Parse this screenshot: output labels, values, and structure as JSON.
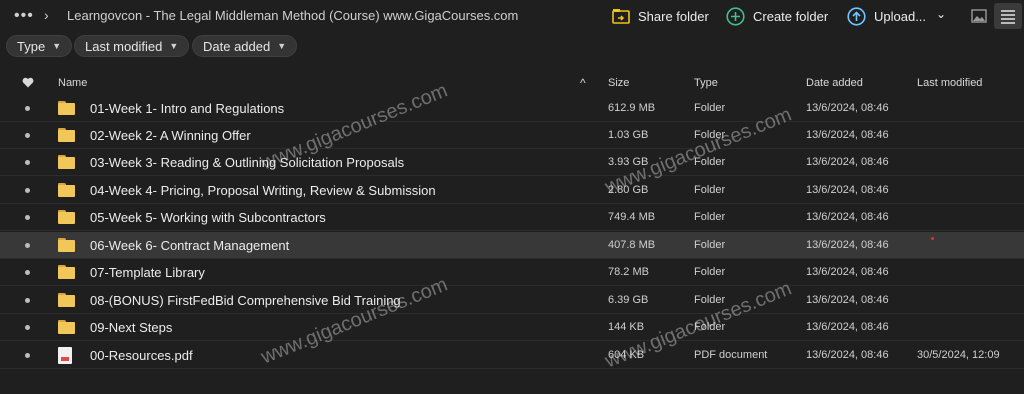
{
  "breadcrumb": {
    "more": "•••",
    "separator": "›",
    "title": "Learngovcon - The Legal Middleman Method (Course) www.GigaCourses.com"
  },
  "toolbar": {
    "share_folder": "Share folder",
    "create_folder": "Create folder",
    "upload": "Upload...",
    "upload_caret": "⌄"
  },
  "filters": [
    {
      "label": "Type"
    },
    {
      "label": "Last modified"
    },
    {
      "label": "Date added"
    }
  ],
  "table": {
    "headers": {
      "name": "Name",
      "size": "Size",
      "type": "Type",
      "date_added": "Date added",
      "last_modified": "Last modified",
      "sort_indicator": "^"
    },
    "rows": [
      {
        "name": "01-Week 1- Intro and Regulations",
        "size": "612.9 MB",
        "type": "Folder",
        "date_added": "13/6/2024, 08:46",
        "last_modified": "",
        "icon": "folder-icon"
      },
      {
        "name": "02-Week 2- A Winning Offer",
        "size": "1.03 GB",
        "type": "Folder",
        "date_added": "13/6/2024, 08:46",
        "last_modified": "",
        "icon": "folder-icon"
      },
      {
        "name": "03-Week 3- Reading & Outlining Solicitation Proposals",
        "size": "3.93 GB",
        "type": "Folder",
        "date_added": "13/6/2024, 08:46",
        "last_modified": "",
        "icon": "folder-icon"
      },
      {
        "name": "04-Week 4- Pricing, Proposal Writing, Review & Submission",
        "size": "2.80 GB",
        "type": "Folder",
        "date_added": "13/6/2024, 08:46",
        "last_modified": "",
        "icon": "folder-icon"
      },
      {
        "name": "05-Week 5- Working with Subcontractors",
        "size": "749.4 MB",
        "type": "Folder",
        "date_added": "13/6/2024, 08:46",
        "last_modified": "",
        "icon": "folder-icon"
      },
      {
        "name": "06-Week 6- Contract Management",
        "size": "407.8 MB",
        "type": "Folder",
        "date_added": "13/6/2024, 08:46",
        "last_modified": "",
        "icon": "folder-icon",
        "selected": true
      },
      {
        "name": "07-Template Library",
        "size": "78.2 MB",
        "type": "Folder",
        "date_added": "13/6/2024, 08:46",
        "last_modified": "",
        "icon": "folder-icon"
      },
      {
        "name": "08-(BONUS) FirstFedBid Comprehensive Bid Training",
        "size": "6.39 GB",
        "type": "Folder",
        "date_added": "13/6/2024, 08:46",
        "last_modified": "",
        "icon": "folder-icon"
      },
      {
        "name": "09-Next Steps",
        "size": "144 KB",
        "type": "Folder",
        "date_added": "13/6/2024, 08:46",
        "last_modified": "",
        "icon": "folder-icon"
      },
      {
        "name": "00-Resources.pdf",
        "size": "604 KB",
        "type": "PDF document",
        "date_added": "13/6/2024, 08:46",
        "last_modified": "30/5/2024, 12:09",
        "icon": "pdf-file-icon"
      }
    ]
  },
  "watermark": "www.gigacourses.com",
  "colors": {
    "background": "#1f1f1f",
    "selected_row": "#383838",
    "folder": "#f2c75a",
    "accent": "#6ec6ff",
    "share_icon": "#f0c419"
  }
}
